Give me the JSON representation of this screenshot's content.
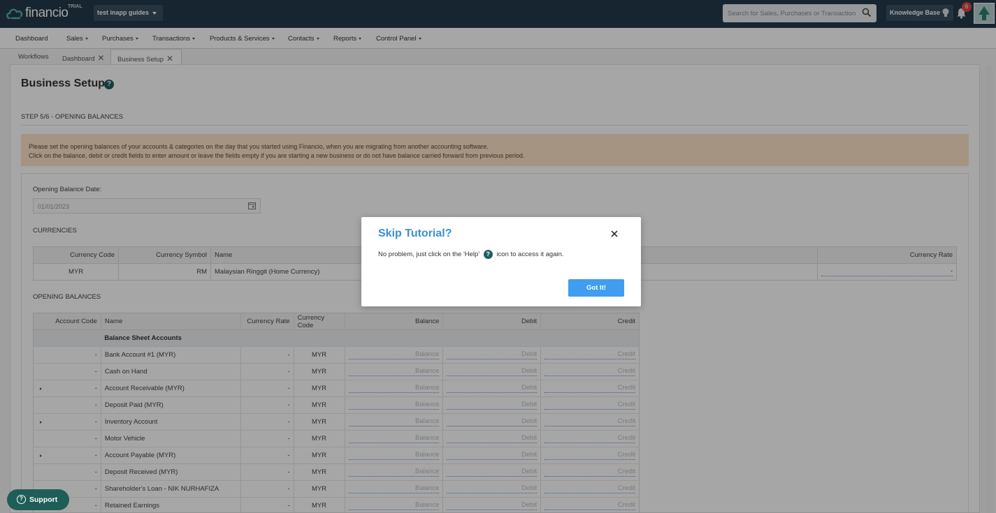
{
  "header": {
    "logo_text": "financio",
    "trial_label": "TRIAL",
    "company_name": "test inapp guides",
    "search_placeholder": "Search for Sales, Purchases or Transactions",
    "knowledge_base_label": "Knowledge Base",
    "notification_count": "6"
  },
  "menu": {
    "items": [
      "Dashboard",
      "Sales",
      "Purchases",
      "Transactions",
      "Products & Services",
      "Contacts",
      "Reports",
      "Control Panel"
    ]
  },
  "tabs": [
    {
      "label": "Workflows"
    },
    {
      "label": "Dashboard"
    },
    {
      "label": "Business Setup"
    }
  ],
  "page": {
    "title": "Business Setup",
    "step": "STEP 5/6 - OPENING BALANCES",
    "alert_line1": "Please set the opening balances of your accounts & categories on the day that you started using Financio, when you are migrating from another accounting software.",
    "alert_line2": "Click on the balance, debit or credit fields to enter amount or leave the fields empty if you are starting a new business or do not have balance carried forward from previous period.",
    "opening_date_label": "Opening Balance Date:",
    "opening_date_value": "01/01/2023",
    "currencies_label": "CURRENCIES",
    "opening_balances_label": "OPENING BALANCES"
  },
  "currencies": {
    "headers": {
      "code": "Currency Code",
      "symbol": "Currency Symbol",
      "name": "Name",
      "rate": "Currency Rate"
    },
    "rows": [
      {
        "code": "MYR",
        "symbol": "RM",
        "name": "Malaysian Ringgit (Home Currency)",
        "rate": "-"
      }
    ]
  },
  "balances": {
    "headers": {
      "account_code": "Account Code",
      "name": "Name",
      "currency_rate": "Currency Rate",
      "currency_code": "Currency Code",
      "balance": "Balance",
      "debit": "Debit",
      "credit": "Credit"
    },
    "group": "Balance Sheet Accounts",
    "placeholders": {
      "balance": "Balance",
      "debit": "Debit",
      "credit": "Credit"
    },
    "rows": [
      {
        "code": "-",
        "name": "Bank Account #1 (MYR)",
        "rate": "-",
        "currency": "MYR",
        "expandable": false
      },
      {
        "code": "-",
        "name": "Cash on Hand",
        "rate": "-",
        "currency": "MYR",
        "expandable": false
      },
      {
        "code": "-",
        "name": "Account Receivable (MYR)",
        "rate": "-",
        "currency": "MYR",
        "expandable": true
      },
      {
        "code": "-",
        "name": "Deposit Paid (MYR)",
        "rate": "-",
        "currency": "MYR",
        "expandable": false
      },
      {
        "code": "-",
        "name": "Inventory Account",
        "rate": "-",
        "currency": "MYR",
        "expandable": true
      },
      {
        "code": "-",
        "name": "Motor Vehicle",
        "rate": "-",
        "currency": "MYR",
        "expandable": false
      },
      {
        "code": "-",
        "name": "Account Payable (MYR)",
        "rate": "-",
        "currency": "MYR",
        "expandable": true
      },
      {
        "code": "-",
        "name": "Deposit Received (MYR)",
        "rate": "-",
        "currency": "MYR",
        "expandable": false
      },
      {
        "code": "-",
        "name": "Shareholder's Loan - NIK NURHAFIZA",
        "rate": "-",
        "currency": "MYR",
        "expandable": false
      },
      {
        "code": "-",
        "name": "Retained Earnings",
        "rate": "-",
        "currency": "MYR",
        "expandable": false
      }
    ]
  },
  "modal": {
    "title": "Skip Tutorial?",
    "body_before": "No problem, just click on the 'Help'",
    "body_after": "icon to access it again.",
    "button": "Got It!"
  },
  "support": {
    "label": "Support"
  },
  "colors": {
    "topbar": "#24394a",
    "accent": "#3f9ef0",
    "brand_teal": "#1f5e63",
    "alert_bg": "#fde3c8",
    "badge": "#e04646"
  }
}
